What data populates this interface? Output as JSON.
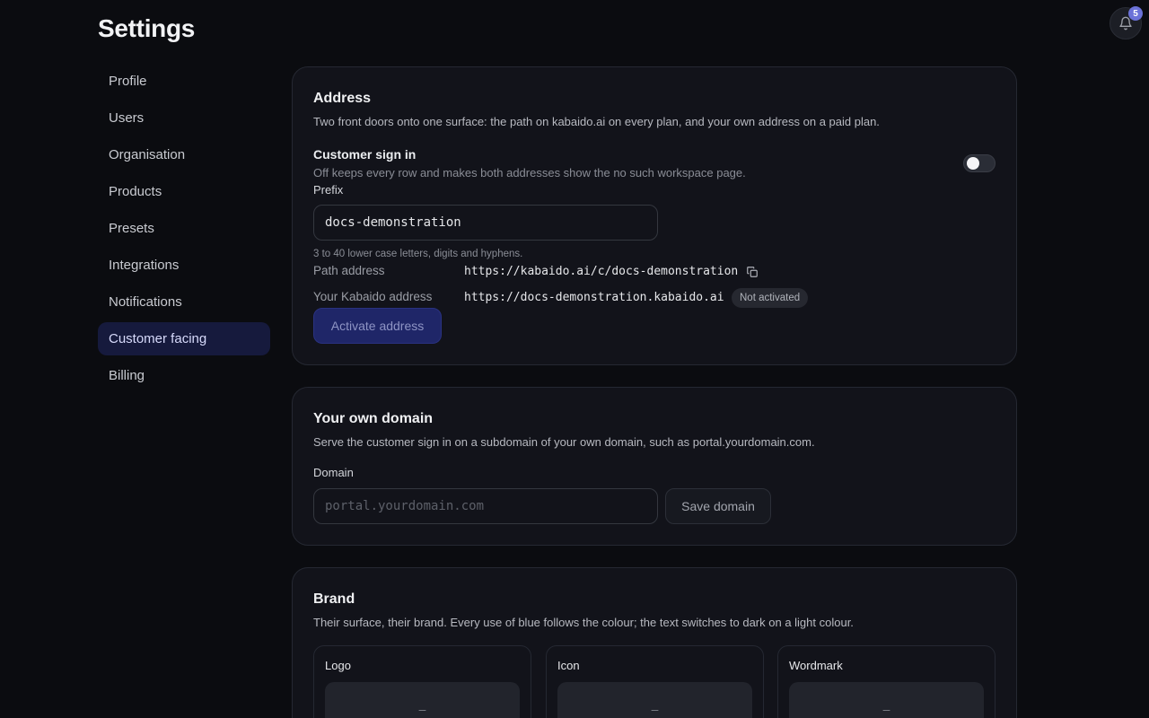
{
  "page": {
    "title": "Settings"
  },
  "notifications": {
    "count": "5"
  },
  "sidebar": {
    "items": [
      {
        "label": "Profile"
      },
      {
        "label": "Users"
      },
      {
        "label": "Organisation"
      },
      {
        "label": "Products"
      },
      {
        "label": "Presets"
      },
      {
        "label": "Integrations"
      },
      {
        "label": "Notifications"
      },
      {
        "label": "Customer facing",
        "active": true
      },
      {
        "label": "Billing"
      }
    ]
  },
  "address": {
    "title": "Address",
    "description": "Two front doors onto one surface: the path on kabaido.ai on every plan, and your own address on a paid plan.",
    "sign_in_label": "Customer sign in",
    "sign_in_hint": "Off keeps every row and makes both addresses show the no such workspace page.",
    "sign_in_enabled": false,
    "prefix_label": "Prefix",
    "prefix_value": "docs-demonstration",
    "prefix_hint": "3 to 40 lower case letters, digits and hyphens.",
    "path_label": "Path address",
    "path_value": "https://kabaido.ai/c/docs-demonstration",
    "own_label": "Your Kabaido address",
    "own_value": "https://docs-demonstration.kabaido.ai",
    "own_status": "Not activated",
    "activate_label": "Activate address"
  },
  "domain": {
    "title": "Your own domain",
    "description": "Serve the customer sign in on a subdomain of your own domain, such as portal.yourdomain.com.",
    "field_label": "Domain",
    "placeholder": "portal.yourdomain.com",
    "value": "",
    "save_label": "Save domain"
  },
  "brand": {
    "title": "Brand",
    "description": "Their surface, their brand. Every use of blue follows the colour; the text switches to dark on a light colour.",
    "tiles": [
      {
        "label": "Logo",
        "value": "–"
      },
      {
        "label": "Icon",
        "value": "–"
      },
      {
        "label": "Wordmark",
        "value": "–"
      }
    ]
  },
  "colors": {
    "accent": "#1f2668",
    "active_nav": "#161a3d",
    "badge": "#6b72d8"
  },
  "icons": {
    "bell": "bell-icon",
    "copy": "copy-icon"
  }
}
